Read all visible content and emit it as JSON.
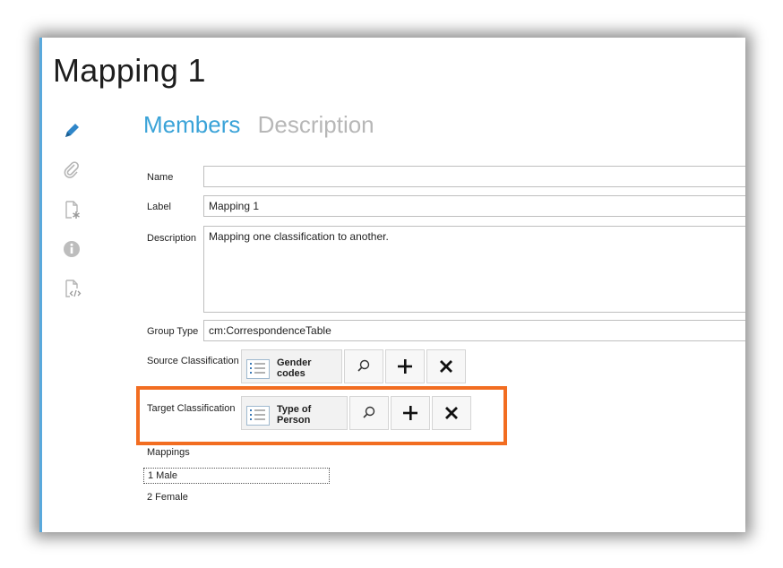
{
  "page": {
    "title": "Mapping 1"
  },
  "sidebar": {
    "icons": [
      "pencil-icon",
      "paperclip-icon",
      "document-star-icon",
      "info-icon",
      "document-code-icon"
    ],
    "accent": "#3a8fd0"
  },
  "tabs": [
    {
      "label": "Members",
      "active": true
    },
    {
      "label": "Description",
      "active": false
    }
  ],
  "form": {
    "name": {
      "label": "Name",
      "value": ""
    },
    "label": {
      "label": "Label",
      "value": "Mapping 1"
    },
    "description": {
      "label": "Description",
      "value": "Mapping one classification to another."
    },
    "group_type": {
      "label": "Group Type",
      "value": "cm:CorrespondenceTable"
    },
    "source_classification": {
      "label": "Source Classification",
      "value": "Gender codes"
    },
    "target_classification": {
      "label": "Target Classification",
      "value": "Type of Person"
    },
    "mappings": {
      "label": "Mappings",
      "items": [
        "1 Male",
        "2 Female"
      ]
    }
  },
  "colors": {
    "tab_active": "#3aa3d8",
    "tab_inactive": "#b7b7b7",
    "highlight": "#f26d21"
  }
}
